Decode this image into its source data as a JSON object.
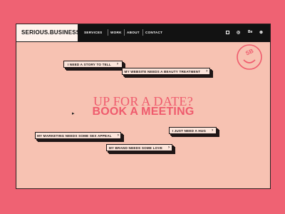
{
  "brand": {
    "name": "SERIOUS.BUSINESS",
    "reg": "®"
  },
  "nav": {
    "links": [
      "SERVICES",
      "WORK",
      "ABOUT",
      "CONTACT"
    ],
    "social": [
      "Be"
    ]
  },
  "headline": {
    "line1": "UP FOR A DATE?",
    "line2": "BOOK A MEETING"
  },
  "badge": {
    "monogram": "SB"
  },
  "buttons": [
    {
      "label": "I NEED A STORY TO TELL",
      "arrow": "›"
    },
    {
      "label": "MY WEBSITE NEEDS A BEAUTY TREATMENT",
      "arrow": "›"
    },
    {
      "label": "MY MARKETING NEEDS SOME SEX APPEAL",
      "arrow": "›"
    },
    {
      "label": "I JUST NEED A HUG",
      "arrow": "›"
    },
    {
      "label": "MY BRAND NEEDS SOME LOVE",
      "arrow": "›"
    }
  ],
  "colors": {
    "page_bg": "#ef6273",
    "canvas": "#f7c2b2",
    "accent": "#ef5b6d",
    "nav_bg": "#121212"
  },
  "icons": [
    "facebook-icon",
    "instagram-icon",
    "behance-icon",
    "dribbble-icon",
    "smiley-logo-icon",
    "chevron-right-icon",
    "mouse-cursor-icon"
  ]
}
